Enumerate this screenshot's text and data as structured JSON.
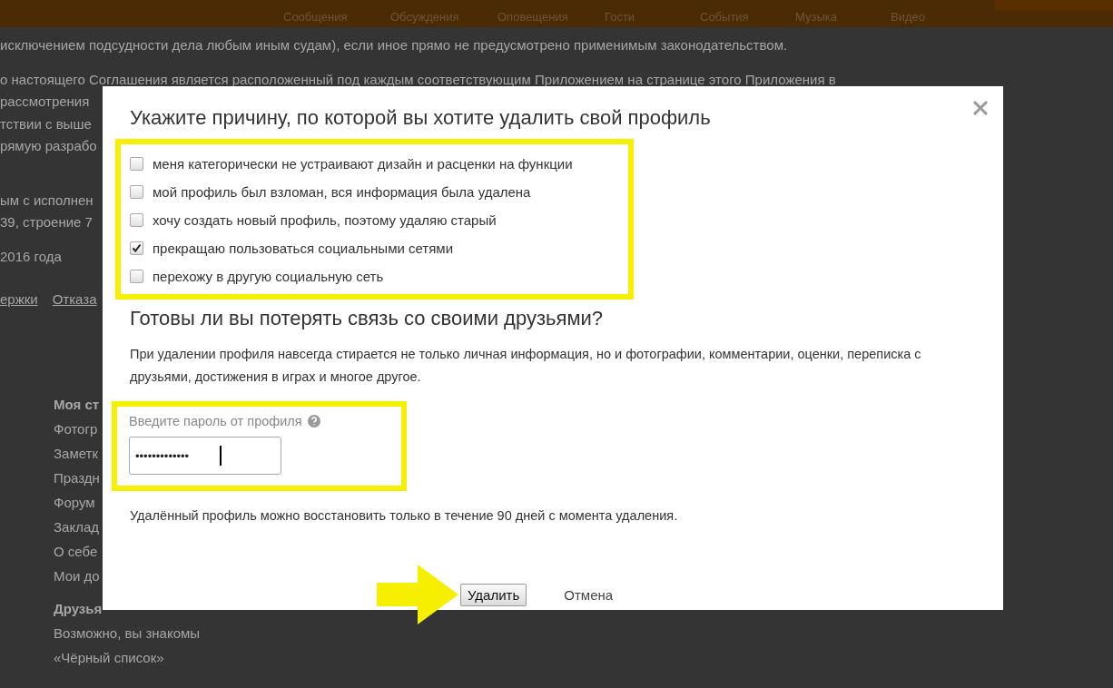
{
  "background_page": {
    "nav": [
      "Сообщения",
      "Обсуждения",
      "Оповещения",
      "Гости",
      "События",
      "Музыка",
      "Видео"
    ],
    "paragraphs": [
      [
        "исключением подсудности дела любым иным судам), если иное прямо не предусмотрено применимым законодательством."
      ],
      [
        "о настоящего Соглашения является расположенный под каждым соответствующим Приложением на странице этого Приложения в",
        "рассмотрения",
        "тствии с выше",
        "рямую разрабо"
      ],
      [
        "ым с исполнен",
        "39, строение 7"
      ],
      [
        "2016 года"
      ]
    ],
    "links": [
      "ержки",
      "Отказа"
    ],
    "menu_sections": [
      {
        "title": "Моя ст",
        "items": [
          "Фотогр",
          "Заметк",
          "Праздн",
          "Форум",
          "Заклад",
          "О себе",
          "Мои до"
        ]
      },
      {
        "title": "Друзья",
        "items": [
          "Возможно, вы знакомы",
          "«Чёрный список»"
        ]
      }
    ]
  },
  "dialog": {
    "title": "Укажите причину, по которой вы хотите удалить свой профиль",
    "reasons": [
      {
        "label": "меня категорически не устраивают дизайн и расценки на функции",
        "checked": false
      },
      {
        "label": "мой профиль был взломан, вся информация была удалена",
        "checked": false
      },
      {
        "label": "хочу создать новый профиль, поэтому удаляю старый",
        "checked": false
      },
      {
        "label": "прекращаю пользоваться социальными сетями",
        "checked": true
      },
      {
        "label": "перехожу в другую социальную сеть",
        "checked": false
      }
    ],
    "subtitle": "Готовы ли вы потерять связь со своими друзьями?",
    "description": "При удалении профиля навсегда стирается не только личная информация, но и фотографии, комментарии, оценки, переписка с друзьями, достижения в играх и многое другое.",
    "password": {
      "label": "Введите пароль от профиля",
      "value": "•••••••••••••"
    },
    "note": "Удалённый профиль можно восстановить только в течение 90 дней с момента удаления.",
    "buttons": {
      "confirm": "Удалить",
      "cancel": "Отмена"
    }
  }
}
